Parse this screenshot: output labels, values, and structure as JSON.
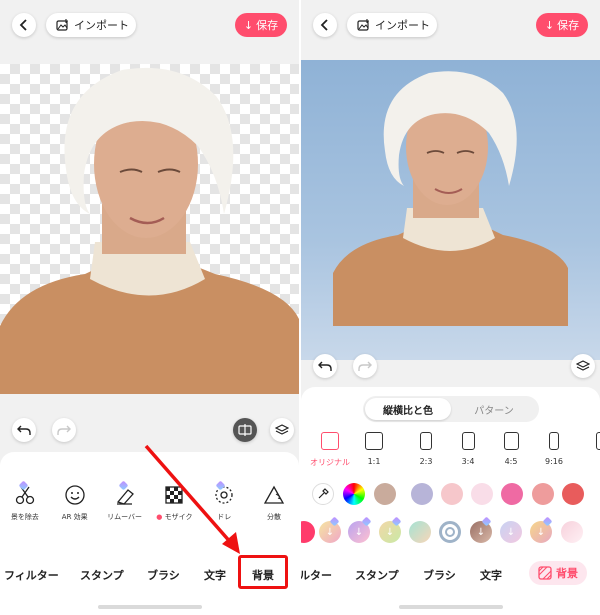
{
  "left": {
    "import_label": "インポート",
    "save_label": "保存",
    "tools": [
      {
        "label": "景を除去",
        "icon": "scissors-icon"
      },
      {
        "label": "AR 効果",
        "icon": "smile-icon"
      },
      {
        "label": "リムーバー",
        "icon": "eraser-icon"
      },
      {
        "label": "モザイク",
        "icon": "mosaic-icon"
      },
      {
        "label": "ドレ",
        "icon": "circle-dashed-icon"
      },
      {
        "label": "分散",
        "icon": "triangle-icon"
      }
    ],
    "tabs": [
      "フィルター",
      "スタンプ",
      "ブラシ",
      "文字",
      "背景"
    ]
  },
  "right": {
    "import_label": "インポート",
    "save_label": "保存",
    "segments": [
      "縦横比と色",
      "パターン"
    ],
    "ratios": [
      "オリジナル",
      "1:1",
      "2:3",
      "3:4",
      "4:5",
      "9:16"
    ],
    "colors": [
      "#c9ab9c",
      "#b7b4d8",
      "#f6c7cb",
      "#f9dde8",
      "#ef6aa3",
      "#ee9c9c",
      "#e85c5c"
    ],
    "tabs": [
      "ルター",
      "スタンプ",
      "ブラシ",
      "文字"
    ],
    "active_tab": "背景"
  },
  "accent": "#ff4d6d"
}
